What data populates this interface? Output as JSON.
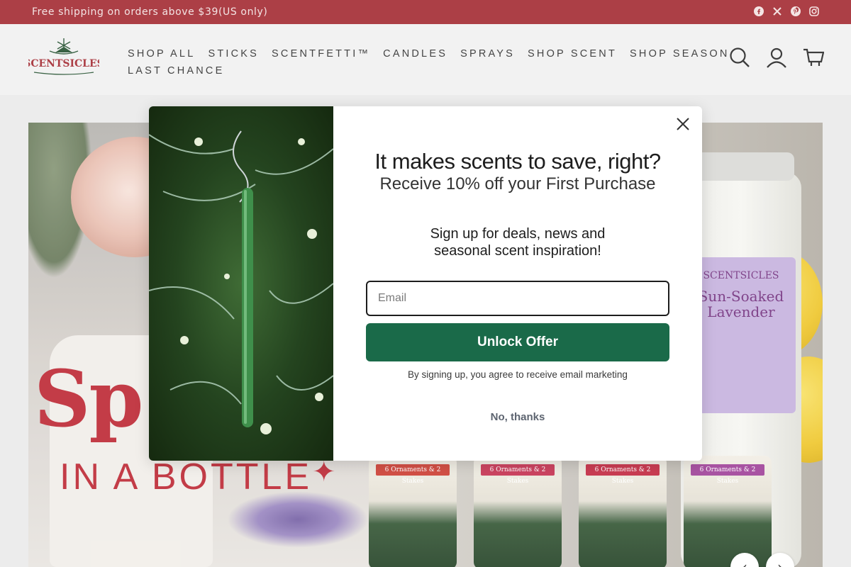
{
  "announcement": {
    "text": "Free shipping on orders above $39(US only)",
    "social_icons": [
      "facebook-icon",
      "x-icon",
      "pinterest-icon",
      "instagram-icon"
    ]
  },
  "header": {
    "logo_text": "SCENTSICLES",
    "nav": [
      "SHOP ALL",
      "STICKS",
      "SCENTFETTI™",
      "CANDLES",
      "SPRAYS",
      "SHOP SCENT",
      "SHOP SEASON",
      "LAST CHANCE"
    ],
    "icons": [
      "search-icon",
      "account-icon",
      "cart-icon"
    ]
  },
  "hero": {
    "headline_partial": "Sp",
    "subline": "IN A BOTTLE",
    "jar_brand": "SCENTSICLES",
    "jar_name": "Sun-Soaked Lavender",
    "tube_tags": [
      "6 Ornaments & 2 Stakes",
      "6 Ornaments & 2 Stakes",
      "6 Ornaments & 2 Stakes",
      "6 Ornaments & 2 Stakes"
    ],
    "prev_label": "‹",
    "next_label": "›"
  },
  "modal": {
    "headline": "It makes scents to save, right?",
    "subhead": "Receive 10% off your First Purchase",
    "body_line1": "Sign up for deals, news and",
    "body_line2": "seasonal scent inspiration!",
    "email_placeholder": "Email",
    "unlock_label": "Unlock Offer",
    "disclaimer": "By signing up, you agree to receive email marketing",
    "no_thanks_label": "No, thanks",
    "accent_color": "#1a6a49"
  },
  "colors": {
    "announcement_bg": "#a8353d",
    "brand_red": "#c0323e",
    "button_green": "#1a6a49"
  }
}
